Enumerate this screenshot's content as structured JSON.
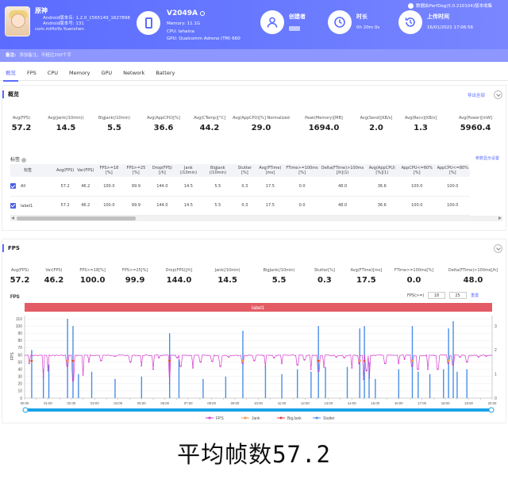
{
  "header": {
    "app": {
      "name": "原神",
      "android_version": "Android版本名: 1.2.0_1565149_1627898",
      "android_code": "Android版本号: 131",
      "package": "com.miHoYo.Yuanshen"
    },
    "device": {
      "name": "V2049A",
      "memory": "Memory: 11.1G",
      "cpu": "CPU: lahaina",
      "gpu": "GPU: Qualcomm Adreno (TM) 660"
    },
    "creator_label": "创建者",
    "duration_label": "时长",
    "duration_value": "0h 20m 0s",
    "upload_label": "上传时间",
    "upload_value": "16/01/2021 17:06:56",
    "version": "数据由PerfDog(5.0.210104)版本收集"
  },
  "note": {
    "label": "备注:",
    "placeholder": "添加备注，不超过200个字"
  },
  "tabs": [
    "概览",
    "FPS",
    "CPU",
    "Memory",
    "GPU",
    "Network",
    "Battery"
  ],
  "overview": {
    "title": "概览",
    "export_label": "导出全部",
    "metrics": [
      {
        "label": "Avg(FPS)",
        "value": "57.2"
      },
      {
        "label": "Avg(Jank(/10min))",
        "value": "14.5"
      },
      {
        "label": "BigJank(/10min)",
        "value": "5.5"
      },
      {
        "label": "Avg(AppCPU)[%]",
        "value": "36.6"
      },
      {
        "label": "Avg(CTemp)[°C]",
        "value": "44.2"
      },
      {
        "label": "Avg(AppCPU)[%] Normalized",
        "value": "29.0"
      },
      {
        "label": "Peak(Memory)[MB]",
        "value": "1694.0"
      },
      {
        "label": "Avg(Send)[KB/s]",
        "value": "2.0"
      },
      {
        "label": "Avg(Recv)[KB/s]",
        "value": "1.3"
      },
      {
        "label": "Avg(Power)[mW]",
        "value": "5960.4"
      }
    ],
    "tags_title": "标签",
    "tags_link": "参数显示设置",
    "table": {
      "headers": [
        "标签",
        "Avg(FPS)",
        "Var(FPS)",
        "FPS>=18 [%]",
        "FPS>=25 [%]",
        "Drop(FPS) [/h]",
        "Jank (/10min)",
        "BigJank (/10min)",
        "Stutter [%]",
        "Avg(FTime) [ms]",
        "FTime>=100ms [%]",
        "Delta(FTime)>100ms [/h](1)",
        "Avg(AppCPU) [%](1)",
        "AppCPU<=60% [%]",
        "AppCPU<=80% [%]"
      ],
      "rows": [
        [
          "All",
          "57.2",
          "46.2",
          "100.0",
          "99.9",
          "144.0",
          "14.5",
          "5.5",
          "0.3",
          "17.5",
          "0.0",
          "48.0",
          "36.6",
          "100.0",
          "100.0"
        ],
        [
          "label1",
          "57.2",
          "46.2",
          "100.0",
          "99.9",
          "144.0",
          "14.5",
          "5.5",
          "0.3",
          "17.5",
          "0.0",
          "48.0",
          "36.6",
          "100.0",
          "100.0"
        ]
      ]
    }
  },
  "fps_panel": {
    "title": "FPS",
    "metrics": [
      {
        "label": "Avg(FPS)",
        "value": "57.2"
      },
      {
        "label": "Var(FPS)",
        "value": "46.2"
      },
      {
        "label": "FPS>=18[%]",
        "value": "100.0"
      },
      {
        "label": "FPS>=25[%]",
        "value": "99.9"
      },
      {
        "label": "Drop(FPS)[/h]",
        "value": "144.0"
      },
      {
        "label": "Jank(/10min)",
        "value": "14.5"
      },
      {
        "label": "BigJank(/10min)",
        "value": "5.5"
      },
      {
        "label": "Stutter[%]",
        "value": "0.3"
      },
      {
        "label": "Avg(FTime)[ms]",
        "value": "17.5"
      },
      {
        "label": "FTime>=100ms[%]",
        "value": "0.0"
      },
      {
        "label": "Delta(FTime)>100ms[/h]",
        "value": "48.0"
      }
    ],
    "filter_label": "FPS(>=)",
    "filter_a": "18",
    "filter_b": "25",
    "filter_reset": "重置"
  },
  "chart_data": {
    "type": "line",
    "title": "FPS",
    "label_band": "label1",
    "ylabel": "FPS",
    "ylim": [
      0,
      110
    ],
    "yticks": [
      0,
      10,
      20,
      30,
      40,
      50,
      60,
      70,
      80,
      90,
      100,
      110
    ],
    "y2ticks": [
      0,
      1,
      2,
      3
    ],
    "y2lim": [
      0,
      3.3
    ],
    "xlim_seconds": [
      0,
      1200
    ],
    "xticks": [
      "00:00",
      "00:30",
      "01:00",
      "01:30",
      "02:00",
      "02:30",
      "03:00",
      "03:30",
      "04:00",
      "04:30",
      "05:00",
      "05:30",
      "06:00",
      "06:30",
      "07:00",
      "07:30",
      "08:00",
      "08:30",
      "09:00",
      "09:30",
      "10:00",
      "10:30",
      "11:00",
      "11:30",
      "12:00",
      "12:30",
      "13:00",
      "13:30",
      "14:00",
      "14:30",
      "15:00",
      "15:30",
      "16:00",
      "16:30",
      "17:00",
      "17:30",
      "18:00",
      "18:30",
      "19:00",
      "19:30",
      "20:00"
    ],
    "legend": [
      "FPS",
      "Jank",
      "BigJank",
      "Stutter"
    ],
    "colors": {
      "FPS": "#d63ad0",
      "Jank": "#f29b45",
      "BigJank": "#e0413d",
      "Stutter": "#4a8fe8",
      "band": "#e35b64",
      "axis": "#aaaaaa",
      "range": "#1aa3e8"
    },
    "fps_baseline": 60,
    "fps_dips": [
      {
        "t": 12,
        "v": 48
      },
      {
        "t": 48,
        "v": 28
      },
      {
        "t": 60,
        "v": 38
      },
      {
        "t": 110,
        "v": 44
      },
      {
        "t": 124,
        "v": 24
      },
      {
        "t": 150,
        "v": 32
      },
      {
        "t": 165,
        "v": 50
      },
      {
        "t": 196,
        "v": 52
      },
      {
        "t": 232,
        "v": 58
      },
      {
        "t": 272,
        "v": 50
      },
      {
        "t": 300,
        "v": 45
      },
      {
        "t": 330,
        "v": 40
      },
      {
        "t": 345,
        "v": 56
      },
      {
        "t": 372,
        "v": 20
      },
      {
        "t": 392,
        "v": 56
      },
      {
        "t": 400,
        "v": 44
      },
      {
        "t": 432,
        "v": 42
      },
      {
        "t": 452,
        "v": 50
      },
      {
        "t": 482,
        "v": 51
      },
      {
        "t": 502,
        "v": 44
      },
      {
        "t": 524,
        "v": 57
      },
      {
        "t": 560,
        "v": 48
      },
      {
        "t": 590,
        "v": 52
      },
      {
        "t": 618,
        "v": 44
      },
      {
        "t": 640,
        "v": 56
      },
      {
        "t": 660,
        "v": 48
      },
      {
        "t": 700,
        "v": 46
      },
      {
        "t": 718,
        "v": 53
      },
      {
        "t": 735,
        "v": 40
      },
      {
        "t": 754,
        "v": 37
      },
      {
        "t": 768,
        "v": 43
      },
      {
        "t": 800,
        "v": 57
      },
      {
        "t": 820,
        "v": 56
      },
      {
        "t": 840,
        "v": 42
      },
      {
        "t": 858,
        "v": 48
      },
      {
        "t": 870,
        "v": 26
      },
      {
        "t": 878,
        "v": 38
      },
      {
        "t": 885,
        "v": 28
      },
      {
        "t": 925,
        "v": 48
      },
      {
        "t": 960,
        "v": 48
      },
      {
        "t": 975,
        "v": 54
      },
      {
        "t": 995,
        "v": 44
      },
      {
        "t": 1010,
        "v": 40
      },
      {
        "t": 1035,
        "v": 40
      },
      {
        "t": 1060,
        "v": 40
      },
      {
        "t": 1088,
        "v": 48
      },
      {
        "t": 1100,
        "v": 46
      },
      {
        "t": 1118,
        "v": 57
      },
      {
        "t": 1135,
        "v": 50
      },
      {
        "t": 1165,
        "v": 57
      },
      {
        "t": 1185,
        "v": 58
      }
    ],
    "stutter_spikes": [
      {
        "t": 18,
        "h": 2.0
      },
      {
        "t": 48,
        "h": 1.2
      },
      {
        "t": 62,
        "h": 1.4
      },
      {
        "t": 110,
        "h": 3.3
      },
      {
        "t": 124,
        "h": 3.0
      },
      {
        "t": 138,
        "h": 1.0
      },
      {
        "t": 172,
        "h": 1.1
      },
      {
        "t": 232,
        "h": 0.8
      },
      {
        "t": 300,
        "h": 0.9
      },
      {
        "t": 372,
        "h": 2.7
      },
      {
        "t": 396,
        "h": 1.6
      },
      {
        "t": 458,
        "h": 0.8
      },
      {
        "t": 516,
        "h": 0.9
      },
      {
        "t": 560,
        "h": 2.8
      },
      {
        "t": 618,
        "h": 1.3
      },
      {
        "t": 660,
        "h": 1.0
      },
      {
        "t": 700,
        "h": 1.2
      },
      {
        "t": 735,
        "h": 1.1
      },
      {
        "t": 754,
        "h": 3.0
      },
      {
        "t": 772,
        "h": 1.3
      },
      {
        "t": 828,
        "h": 1.3
      },
      {
        "t": 860,
        "h": 2.9
      },
      {
        "t": 872,
        "h": 3.0
      },
      {
        "t": 884,
        "h": 1.5
      },
      {
        "t": 900,
        "h": 0.8
      },
      {
        "t": 960,
        "h": 1.2
      },
      {
        "t": 995,
        "h": 3.0
      },
      {
        "t": 1010,
        "h": 1.1
      },
      {
        "t": 1040,
        "h": 1.0
      },
      {
        "t": 1075,
        "h": 1.2
      },
      {
        "t": 1088,
        "h": 2.9
      },
      {
        "t": 1100,
        "h": 3.2
      },
      {
        "t": 1110,
        "h": 1.1
      },
      {
        "t": 1135,
        "h": 1.2
      }
    ],
    "jank_points": [
      {
        "t": 18,
        "v": 1.0
      },
      {
        "t": 110,
        "v": 1.0
      },
      {
        "t": 124,
        "v": 1.0
      },
      {
        "t": 372,
        "v": 1.0
      },
      {
        "t": 560,
        "v": 1.0
      },
      {
        "t": 754,
        "v": 1.0
      },
      {
        "t": 860,
        "v": 1.0
      },
      {
        "t": 995,
        "v": 1.0
      },
      {
        "t": 1088,
        "v": 1.0
      }
    ],
    "bigjank_points": [
      {
        "t": 18,
        "v": 1.0
      },
      {
        "t": 124,
        "v": 1.0
      },
      {
        "t": 372,
        "v": 1.0
      },
      {
        "t": 754,
        "v": 1.0
      },
      {
        "t": 872,
        "v": 1.0
      }
    ]
  },
  "caption": "平均帧数57.2"
}
